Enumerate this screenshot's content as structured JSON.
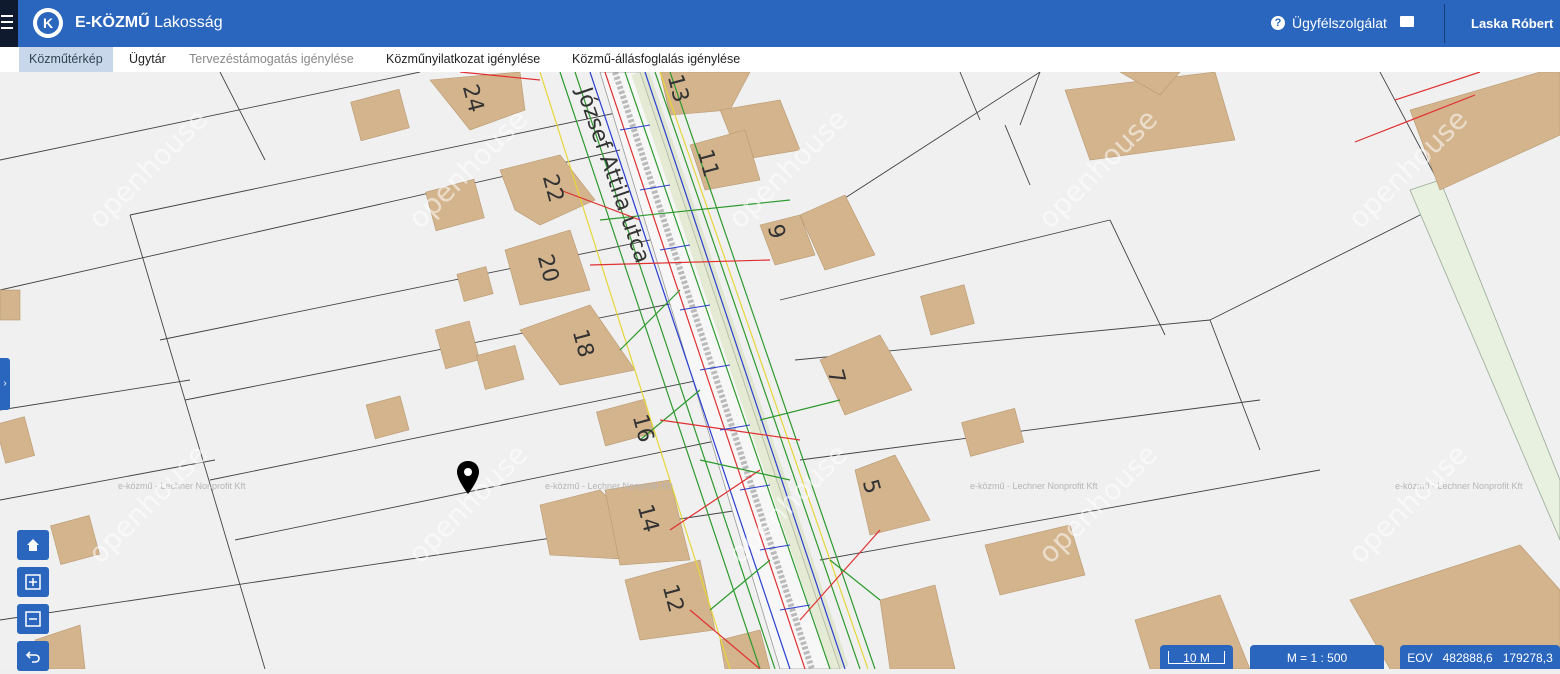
{
  "header": {
    "brand_bold": "E-KÖZMŰ",
    "brand_rest": "Lakosság",
    "logo_letter": "K",
    "help_label": "Ügyfélszolgálat",
    "user_name": "Laska Róbert"
  },
  "tabs": [
    {
      "label": "Közműtérkép",
      "state": "active"
    },
    {
      "label": "Ügytár",
      "state": "normal"
    },
    {
      "label": "Tervezéstámogatás igénylése",
      "state": "disabled"
    },
    {
      "label": "Közműnyilatkozat igénylése",
      "state": "normal"
    },
    {
      "label": "Közmű-állásfoglalás igénylése",
      "state": "normal"
    }
  ],
  "map": {
    "street_name": "József Attila utca",
    "house_numbers": [
      "24",
      "22",
      "20",
      "18",
      "16",
      "14",
      "12",
      "13",
      "11",
      "9",
      "7",
      "5"
    ],
    "watermark_text": "openhouse",
    "copyright_text": "e-közmű - Lechner Nonprofit Kft",
    "controls": [
      "home-icon",
      "zoom-in-icon",
      "zoom-out-icon",
      "back-icon"
    ]
  },
  "status": {
    "scale_label": "10 M",
    "ratio_label": "M = 1 : 500",
    "coord_label": "EOV",
    "coord_x": "482888,6",
    "coord_y": "179278,3"
  },
  "colors": {
    "header_blue": "#2a66bd",
    "building": "#d3b48c",
    "utility_green": "#2e9a2e",
    "utility_red": "#e03030",
    "utility_blue": "#2a3fd0",
    "utility_yellow": "#e6d63a"
  }
}
